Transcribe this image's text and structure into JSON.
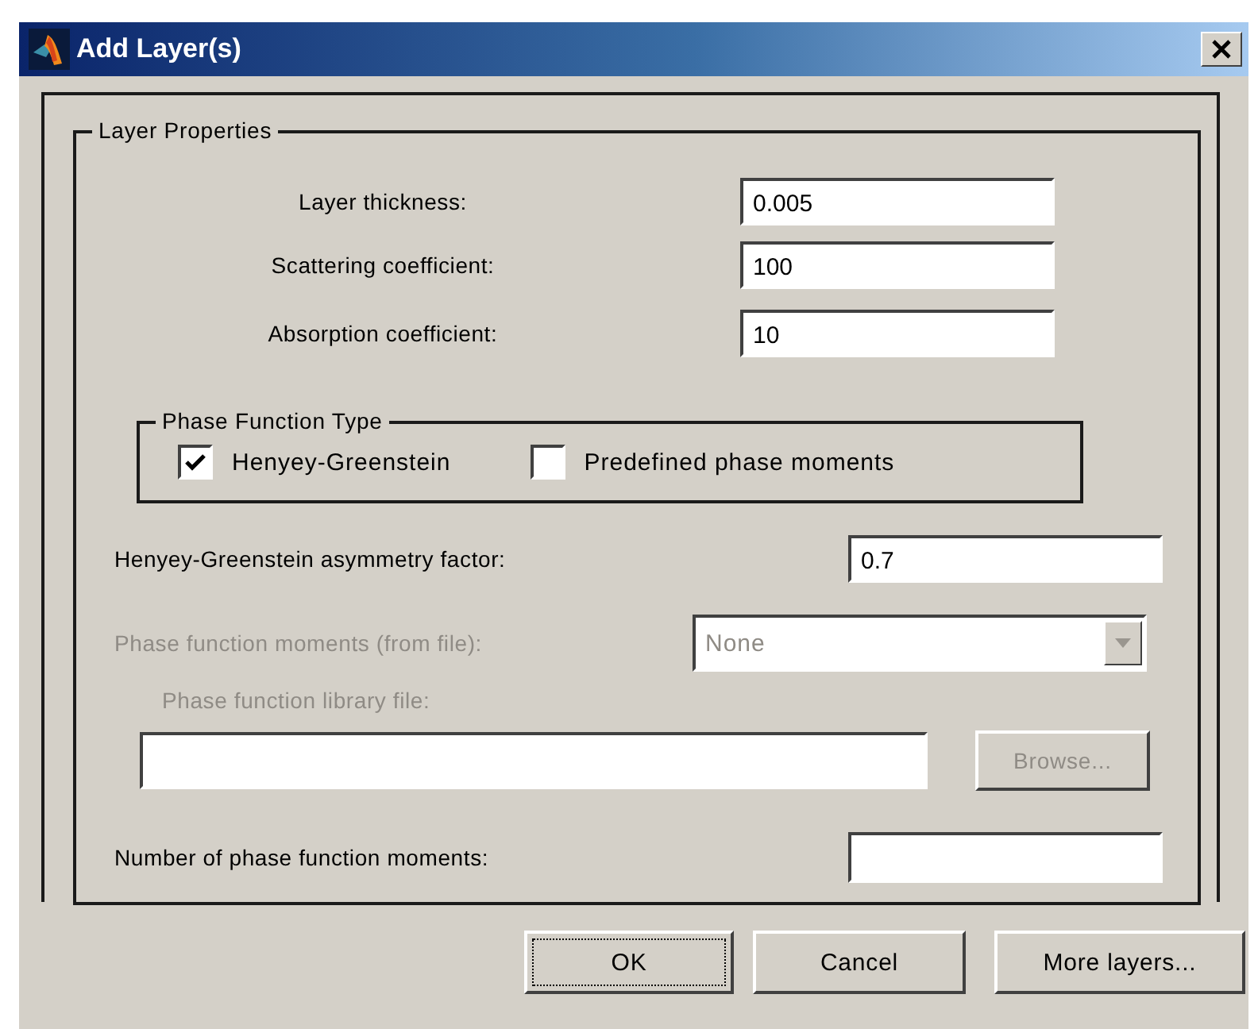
{
  "window": {
    "title": "Add Layer(s)"
  },
  "layer_properties": {
    "title": "Layer Properties",
    "fields": [
      {
        "label": "Layer thickness:",
        "value": "0.005"
      },
      {
        "label": "Scattering coefficient:",
        "value": "100"
      },
      {
        "label": "Absorption coefficient:",
        "value": "10"
      }
    ],
    "phase_function_type": {
      "title": "Phase Function Type",
      "options": [
        {
          "label": "Henyey-Greenstein",
          "checked": true
        },
        {
          "label": "Predefined phase moments",
          "checked": false
        }
      ]
    },
    "asymmetry_factor": {
      "label": "Henyey-Greenstein asymmetry factor:",
      "value": "0.7"
    },
    "moments_from_file": {
      "label": "Phase function moments (from file):",
      "value": "None",
      "disabled": true
    },
    "library_file": {
      "label": "Phase function library file:",
      "browse": "Browse...",
      "disabled": true
    },
    "number_of_moments": {
      "label": "Number of phase function moments:"
    }
  },
  "buttons": [
    {
      "label": "OK",
      "focused": true
    },
    {
      "label": "Cancel",
      "focused": false
    },
    {
      "label": "More layers...",
      "focused": false
    }
  ]
}
